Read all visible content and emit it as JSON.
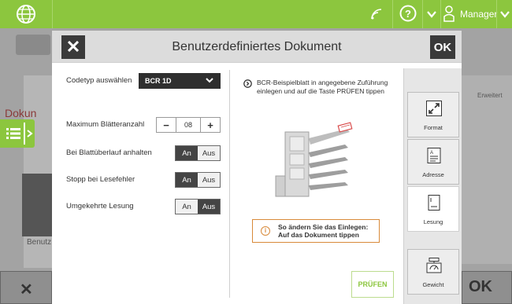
{
  "topbar": {
    "user_label": "Manager",
    "icons": [
      "globe-icon",
      "wifi-icon",
      "help-icon",
      "chevron-down-icon",
      "user-icon",
      "chevron-down-icon"
    ]
  },
  "background": {
    "doc_text": "Dokun",
    "benutz_text": "Benutz",
    "erweitert_text": "Erweitert",
    "ok_text": "OK"
  },
  "dialog": {
    "title": "Benutzerdefiniertes Dokument",
    "close_label": "✕",
    "ok_label": "OK",
    "settings": {
      "codetyp_label": "Codetyp auswählen",
      "codetyp_value": "BCR 1D",
      "max_sheets_label": "Maximum Blätteranzahl",
      "max_sheets_value": "08",
      "minus_label": "−",
      "plus_label": "+",
      "overflow_label": "Bei Blattüberlauf anhalten",
      "readerror_label": "Stopp bei Lesefehler",
      "reverse_label": "Umgekehrte Lesung",
      "on_label": "An",
      "off_label": "Aus",
      "overflow_state": "An",
      "readerror_state": "An",
      "reverse_state": "Aus"
    },
    "instruction": "BCR-Beispielblatt in angegebene Zuführung einlegen und auf die Taste PRÜFEN tippen",
    "info_text_line1": "So ändern Sie das Einlegen:",
    "info_text_line2": "Auf das Dokument tippen",
    "pruefen_label": "PRÜFEN",
    "tabs": [
      {
        "label": "Format",
        "icon": "expand-arrows-icon",
        "active": false
      },
      {
        "label": "Adresse",
        "icon": "address-document-icon",
        "active": false
      },
      {
        "label": "Lesung",
        "icon": "document-icon",
        "active": true
      },
      {
        "label": "Gewicht",
        "icon": "scale-icon",
        "active": false
      }
    ]
  },
  "colors": {
    "brand_green": "#8cc63e",
    "dark_button": "#3a3a3a",
    "accent_red": "#d94a4a",
    "info_orange": "#d88a3a"
  }
}
